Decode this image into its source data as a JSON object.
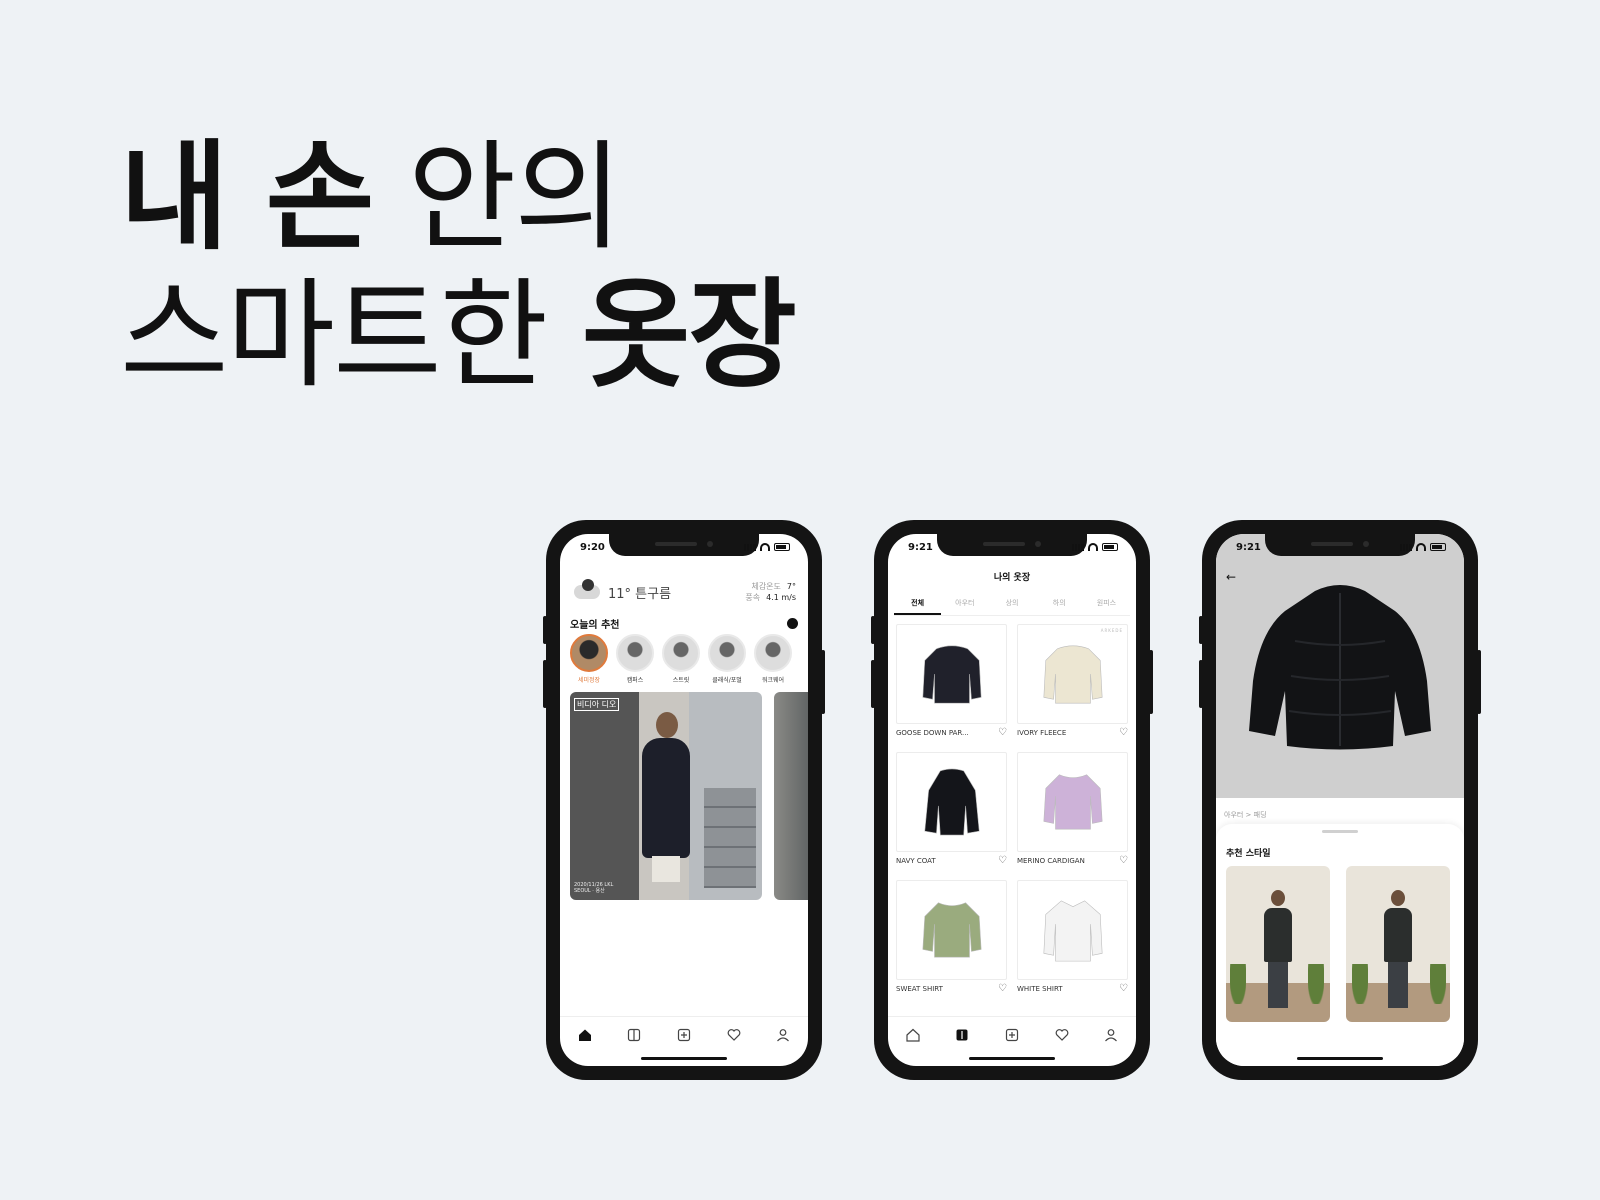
{
  "headline": {
    "line1_bold": "내 손",
    "line1_light": " 안의",
    "line2_light": "스마트한 ",
    "line2_bold": "옷장"
  },
  "phone1": {
    "time": "9:20",
    "weather": {
      "temp_label": "11° 튼구름",
      "feels_label": "체감온도",
      "feels_value": "7°",
      "wind_label": "풍속",
      "wind_value": "4.1 m/s"
    },
    "section_title": "오늘의 추천",
    "styles": [
      {
        "label": "세미정장"
      },
      {
        "label": "캠퍼스"
      },
      {
        "label": "스트릿"
      },
      {
        "label": "클래식/포멀"
      },
      {
        "label": "워크웨어"
      }
    ],
    "feed_card": {
      "tag": "비디아 디오",
      "caption_line1": "2020/11/26 LKL",
      "caption_line2": "SEOUL · 용산"
    }
  },
  "phone2": {
    "time": "9:21",
    "title": "나의 옷장",
    "tabs": [
      "전체",
      "아우터",
      "상의",
      "하의",
      "원피스"
    ],
    "items": [
      {
        "name": "GOOSE DOWN PAR...",
        "brand": "",
        "color": "#20212b",
        "shape": "jacket"
      },
      {
        "name": "IVORY FLEECE",
        "brand": "ARKEDE",
        "color": "#ece6d2",
        "shape": "jacket"
      },
      {
        "name": "NAVY COAT",
        "brand": "",
        "color": "#14151a",
        "shape": "coat"
      },
      {
        "name": "MERINO CARDIGAN",
        "brand": "",
        "color": "#cdb2d8",
        "shape": "sweater"
      },
      {
        "name": "SWEAT SHIRT",
        "brand": "",
        "color": "#9aab7e",
        "shape": "sweater"
      },
      {
        "name": "WHITE SHIRT",
        "brand": "",
        "color": "#f3f3f3",
        "shape": "shirt"
      }
    ]
  },
  "phone3": {
    "time": "9:21",
    "breadcrumb": "아우터 > 패딩",
    "sheet_title": "추천 스타일"
  }
}
